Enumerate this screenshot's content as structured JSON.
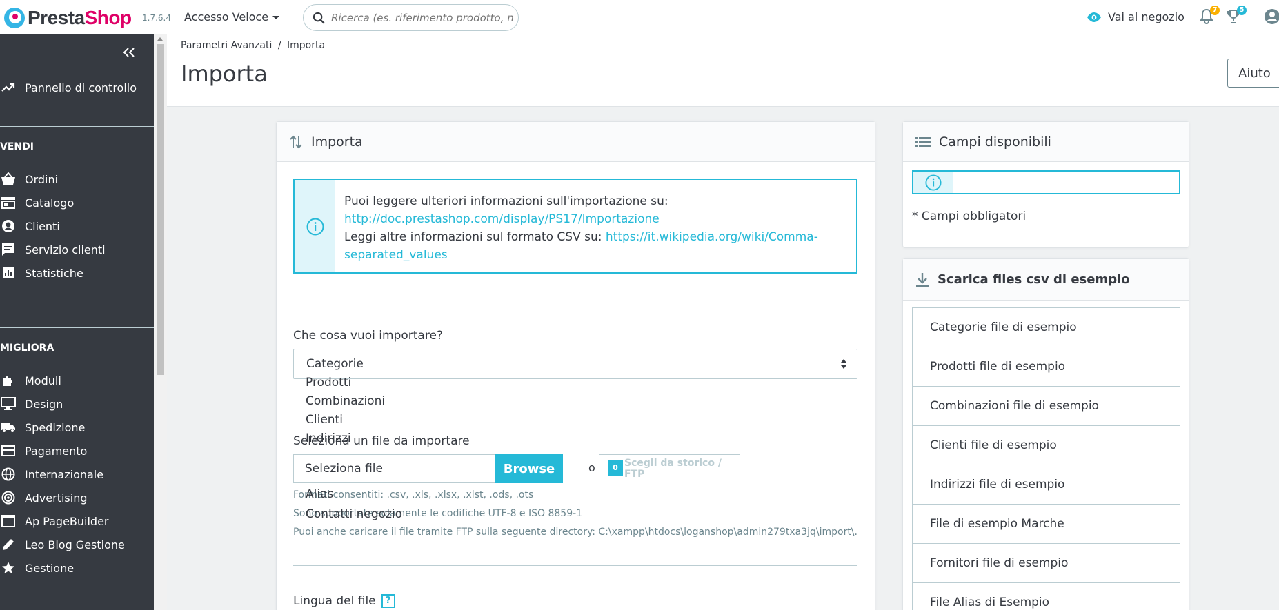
{
  "header": {
    "logo_part1": "Presta",
    "logo_part2": "Shop",
    "version": "1.7.6.4",
    "quick_access": "Accesso Veloce",
    "search_placeholder": "Ricerca (es. riferimento prodotto, nome",
    "store_link": "Vai al negozio",
    "notifications": [
      {
        "icon": "bell-icon",
        "count": "7",
        "color": "#fab000"
      },
      {
        "icon": "trophy-icon",
        "count": "5",
        "color": "#25b9d7"
      }
    ]
  },
  "sidebar": {
    "dashboard": "Pannello di controllo",
    "sections": [
      {
        "title": "VENDI",
        "items": [
          {
            "label": "Ordini",
            "icon": "basket-icon"
          },
          {
            "label": "Catalogo",
            "icon": "store-icon"
          },
          {
            "label": "Clienti",
            "icon": "account-icon"
          },
          {
            "label": "Servizio clienti",
            "icon": "chat-icon"
          },
          {
            "label": "Statistiche",
            "icon": "chart-icon"
          }
        ]
      },
      {
        "title": "MIGLIORA",
        "items": [
          {
            "label": "Moduli",
            "icon": "puzzle-icon"
          },
          {
            "label": "Design",
            "icon": "desktop-icon"
          },
          {
            "label": "Spedizione",
            "icon": "truck-icon"
          },
          {
            "label": "Pagamento",
            "icon": "credit-card-icon"
          },
          {
            "label": "Internazionale",
            "icon": "globe-icon"
          },
          {
            "label": "Advertising",
            "icon": "target-icon"
          },
          {
            "label": "Ap PageBuilder",
            "icon": "window-icon"
          },
          {
            "label": "Leo Blog Gestione",
            "icon": "pencil-icon"
          },
          {
            "label": "Gestione",
            "icon": "star-icon"
          }
        ]
      }
    ]
  },
  "page": {
    "breadcrumb_1": "Parametri Avanzati",
    "breadcrumb_sep": "/",
    "breadcrumb_2": "Importa",
    "title": "Importa",
    "help_button": "Aiuto"
  },
  "import_panel": {
    "title": "Importa",
    "info_line1": "Puoi leggere ulteriori informazioni sull'importazione su:",
    "info_link1": "http://doc.prestashop.com/display/PS17/Importazione",
    "info_line2": "Leggi altre informazioni sul formato CSV su:",
    "info_link2a": "https://it.wikipedia.org/wiki/Comma-",
    "info_link2b": "separated_values",
    "what_label": "Che cosa vuoi importare?",
    "selected": "Categorie",
    "options": [
      "Prodotti",
      "Combinazioni",
      "Clienti",
      "Indirizzi",
      "Alias",
      "Contatti negozio"
    ],
    "file_label": "Seleziona un file da importare",
    "file_placeholder": "Seleziona file",
    "browse": "Browse",
    "or": "o",
    "history_count": "0",
    "history_label": "Scegli da storico / FTP",
    "allowed_formats": "Formati consentiti: .csv, .xls, .xlsx, .xlst, .ods, .ots",
    "encodings": "Sono supportate solamente le codifiche UTF-8 e ISO 8859-1",
    "ftp_note": "Puoi anche caricare il file tramite FTP sulla seguente directory: C:\\xampp\\htdocs\\loganshop\\admin279txa3jq\\import\\.",
    "language_label": "Lingua del file",
    "language_help": "?"
  },
  "fields_panel": {
    "title": "Campi disponibili",
    "required_note": "* Campi obbligatori"
  },
  "samples_panel": {
    "title": "Scarica files csv di esempio",
    "items": [
      "Categorie file di esempio",
      "Prodotti file di esempio",
      "Combinazioni file di esempio",
      "Clienti file di esempio",
      "Indirizzi file di esempio",
      "File di esempio Marche",
      "Fornitori file di esempio",
      "File Alias di Esempio"
    ]
  },
  "colors": {
    "accent": "#25b9d7",
    "brand_pink": "#df0067",
    "sidebar": "#363a41"
  }
}
